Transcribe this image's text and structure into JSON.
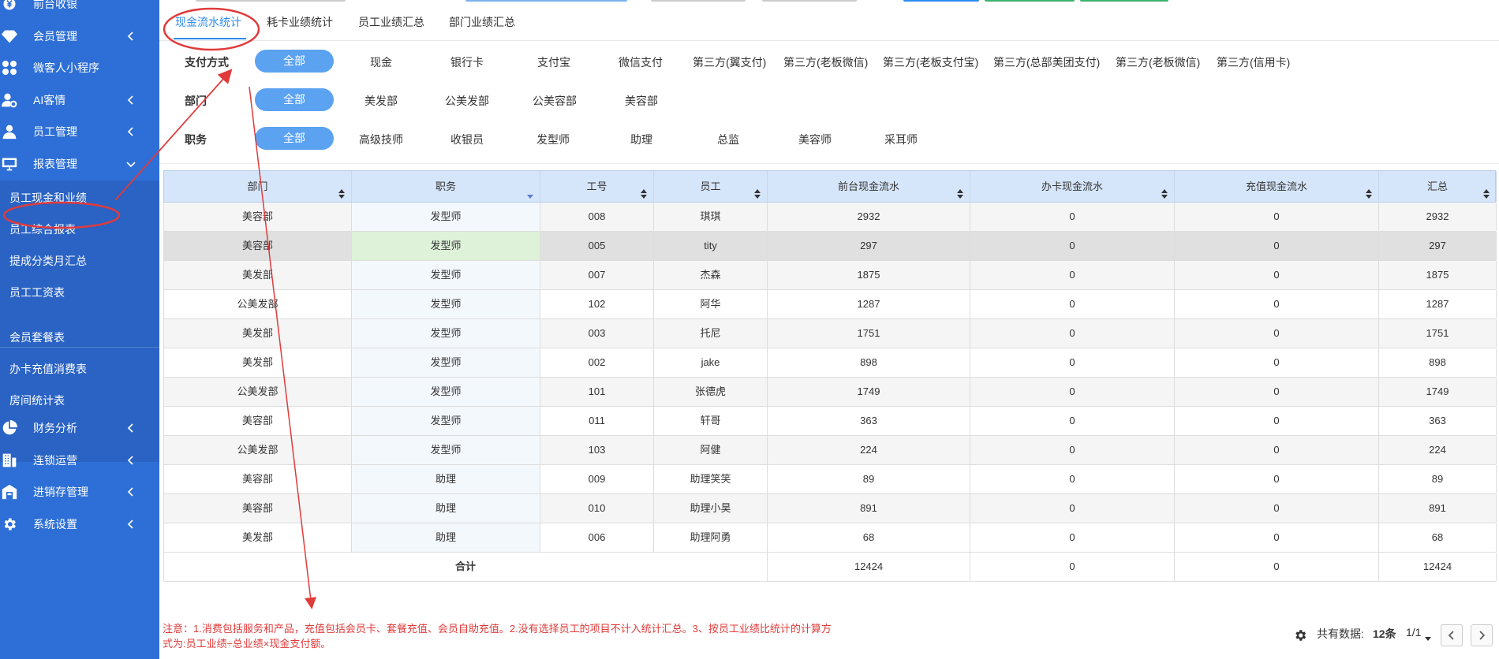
{
  "sidebar": {
    "items": [
      {
        "label": "前台收银",
        "icon": "yen-icon",
        "has_chevron": false
      },
      {
        "label": "会员管理",
        "icon": "diamond-icon",
        "has_chevron": true
      },
      {
        "label": "微客人小程序",
        "icon": "apps-icon",
        "has_chevron": false
      },
      {
        "label": "AI客情",
        "icon": "user-settings-icon",
        "has_chevron": true
      },
      {
        "label": "员工管理",
        "icon": "user-icon",
        "has_chevron": true
      },
      {
        "label": "报表管理",
        "icon": "monitor-icon",
        "has_chevron": true
      }
    ],
    "sub_items": [
      {
        "label": "员工现金和业绩",
        "active": true
      },
      {
        "label": "员工综合报表"
      },
      {
        "label": "提成分类月汇总"
      },
      {
        "label": "员工工资表"
      },
      {
        "label": "会员套餐表"
      },
      {
        "label": "办卡充值消费表"
      },
      {
        "label": "房间统计表"
      }
    ],
    "bottom_items": [
      {
        "label": "财务分析",
        "icon": "pie-chart-icon"
      },
      {
        "label": "连锁运营",
        "icon": "building-icon"
      },
      {
        "label": "进销存管理",
        "icon": "warehouse-icon"
      },
      {
        "label": "系统设置",
        "icon": "gear-icon"
      }
    ]
  },
  "tabs": [
    "现金流水统计",
    "耗卡业绩统计",
    "员工业绩汇总",
    "部门业绩汇总"
  ],
  "filters": {
    "payment": {
      "label": "支付方式",
      "options": [
        "全部",
        "现金",
        "银行卡",
        "支付宝",
        "微信支付",
        "第三方(翼支付)",
        "第三方(老板微信)",
        "第三方(老板支付宝)",
        "第三方(总部美团支付)",
        "第三方(老板微信)",
        "第三方(信用卡)"
      ]
    },
    "department": {
      "label": "部门",
      "options": [
        "全部",
        "美发部",
        "公美发部",
        "公美容部",
        "美容部"
      ]
    },
    "role": {
      "label": "职务",
      "options": [
        "全部",
        "高级技师",
        "收银员",
        "发型师",
        "助理",
        "总监",
        "美容师",
        "采耳师"
      ]
    }
  },
  "table": {
    "headers": [
      "部门",
      "职务",
      "工号",
      "员工",
      "前台现金流水",
      "办卡现金流水",
      "充值现金流水",
      "汇总"
    ],
    "rows": [
      [
        "美容部",
        "发型师",
        "008",
        "琪琪",
        "2932",
        "0",
        "0",
        "2932"
      ],
      [
        "美容部",
        "发型师",
        "005",
        "tity",
        "297",
        "0",
        "0",
        "297"
      ],
      [
        "美发部",
        "发型师",
        "007",
        "杰森",
        "1875",
        "0",
        "0",
        "1875"
      ],
      [
        "公美发部",
        "发型师",
        "102",
        "阿华",
        "1287",
        "0",
        "0",
        "1287"
      ],
      [
        "美发部",
        "发型师",
        "003",
        "托尼",
        "1751",
        "0",
        "0",
        "1751"
      ],
      [
        "美发部",
        "发型师",
        "002",
        "jake",
        "898",
        "0",
        "0",
        "898"
      ],
      [
        "公美发部",
        "发型师",
        "101",
        "张德虎",
        "1749",
        "0",
        "0",
        "1749"
      ],
      [
        "美容部",
        "发型师",
        "011",
        "轩哥",
        "363",
        "0",
        "0",
        "363"
      ],
      [
        "公美发部",
        "发型师",
        "103",
        "阿健",
        "224",
        "0",
        "0",
        "224"
      ],
      [
        "美容部",
        "助理",
        "009",
        "助理笑笑",
        "89",
        "0",
        "0",
        "89"
      ],
      [
        "美容部",
        "助理",
        "010",
        "助理小昊",
        "891",
        "0",
        "0",
        "891"
      ],
      [
        "美发部",
        "助理",
        "006",
        "助理阿勇",
        "68",
        "0",
        "0",
        "68"
      ]
    ],
    "total": {
      "label": "合计",
      "front": "12424",
      "card": "0",
      "recharge": "0",
      "sum": "12424"
    }
  },
  "note": "注意：1.消费包括服务和产品，充值包括会员卡、套餐充值、会员自助充值。2.没有选择员工的项目不计入统计汇总。3、按员工业绩比统计的计算方式为:员工业绩÷总业绩×现金支付额。",
  "pager": {
    "total_label": "共有数据:",
    "count": "12条",
    "pages": "1/1"
  },
  "colors": {
    "sidebar": "#2d6fd6",
    "accent": "#2d8cf0",
    "pill": "#5ba2f1",
    "annotation": "#e03b3b"
  }
}
